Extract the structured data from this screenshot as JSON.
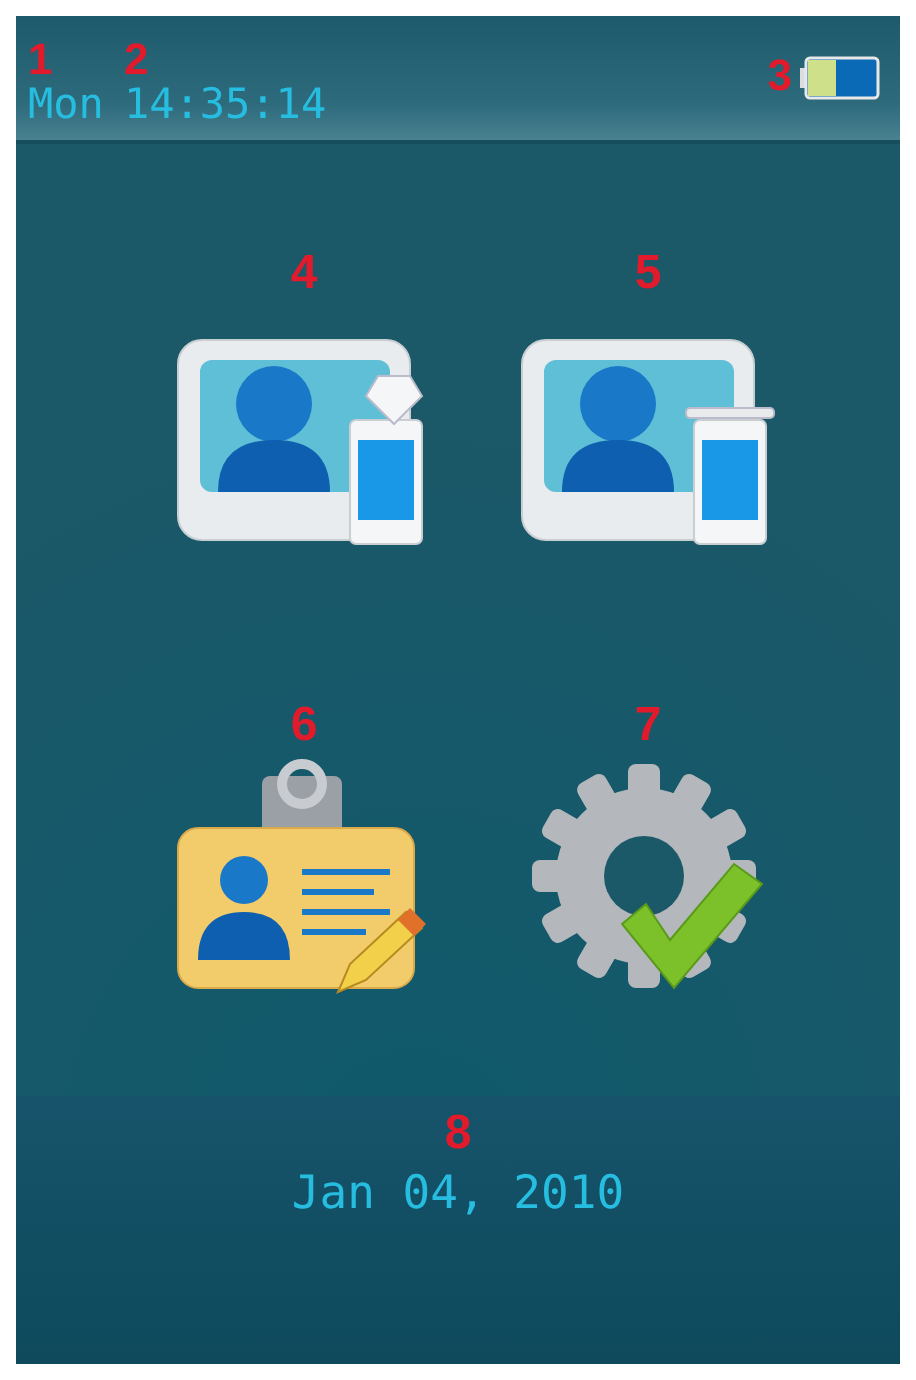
{
  "status_bar": {
    "day": {
      "callout": "1",
      "text": "Mon"
    },
    "time": {
      "callout": "2",
      "text": "14:35:14"
    },
    "battery": {
      "callout": "3"
    }
  },
  "menu": [
    {
      "callout": "4",
      "kind": "user-gem"
    },
    {
      "callout": "5",
      "kind": "user-device"
    },
    {
      "callout": "6",
      "kind": "badge-edit"
    },
    {
      "callout": "7",
      "kind": "gear-check"
    }
  ],
  "footer": {
    "callout": "8",
    "date": "Jan 04, 2010"
  }
}
